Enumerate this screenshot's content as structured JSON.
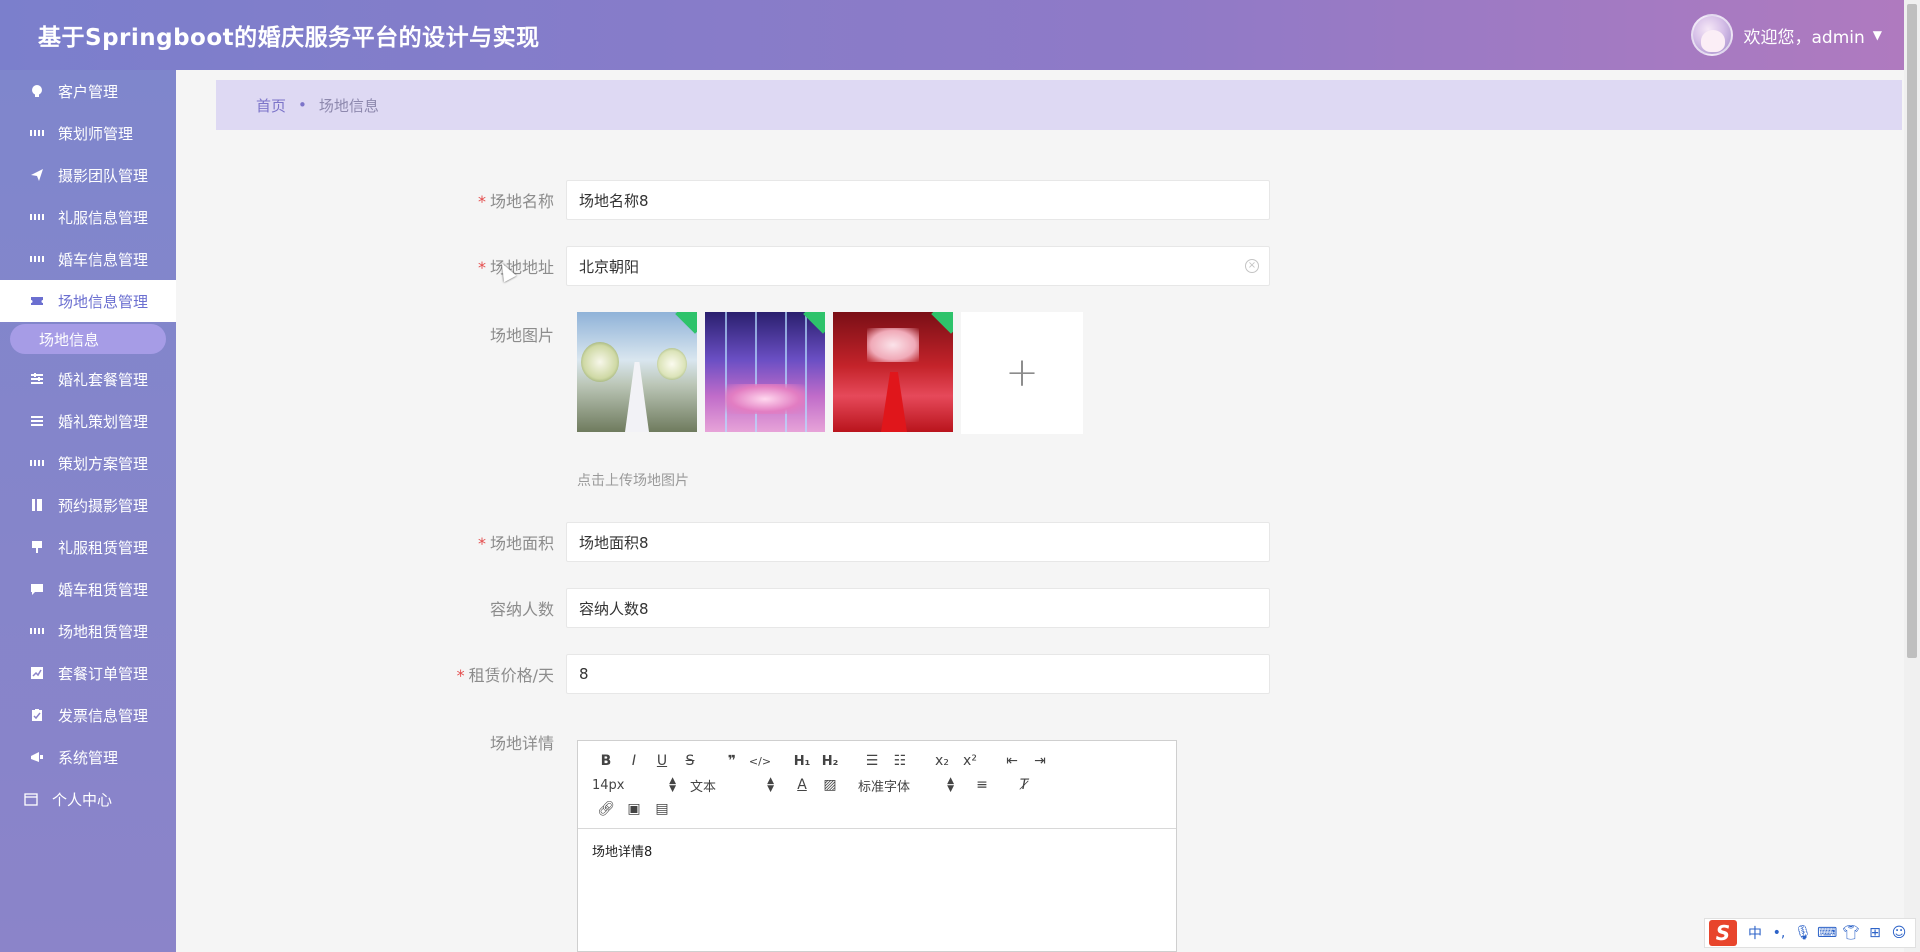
{
  "header": {
    "title": "基于Springboot的婚庆服务平台的设计与实现",
    "welcome": "欢迎您，admin",
    "caret": "▼"
  },
  "sidebar": {
    "items": [
      {
        "label": "客户管理",
        "icon": "bulb-icon"
      },
      {
        "label": "策划师管理",
        "icon": "grid-icon"
      },
      {
        "label": "摄影团队管理",
        "icon": "paper-plane-icon"
      },
      {
        "label": "礼服信息管理",
        "icon": "grid-icon"
      },
      {
        "label": "婚车信息管理",
        "icon": "grid-icon"
      },
      {
        "label": "场地信息管理",
        "icon": "ticket-icon",
        "active": true
      },
      {
        "label": "婚礼套餐管理",
        "icon": "sliders-icon"
      },
      {
        "label": "婚礼策划管理",
        "icon": "list-icon"
      },
      {
        "label": "策划方案管理",
        "icon": "grid-icon"
      },
      {
        "label": "预约摄影管理",
        "icon": "book-icon"
      },
      {
        "label": "礼服租赁管理",
        "icon": "brush-icon"
      },
      {
        "label": "婚车租赁管理",
        "icon": "chat-icon"
      },
      {
        "label": "场地租赁管理",
        "icon": "grid-icon"
      },
      {
        "label": "套餐订单管理",
        "icon": "chart-icon"
      },
      {
        "label": "发票信息管理",
        "icon": "clipboard-icon"
      },
      {
        "label": "系统管理",
        "icon": "megaphone-icon"
      }
    ],
    "sub_item": "场地信息",
    "personal": "个人中心"
  },
  "breadcrumb": {
    "home": "首页",
    "separator": "•",
    "current": "场地信息"
  },
  "form": {
    "venue_name_label": "场地名称",
    "venue_name_value": "场地名称8",
    "venue_address_label": "场地地址",
    "venue_address_value": "北京朝阳",
    "venue_image_label": "场地图片",
    "upload_hint": "点击上传场地图片",
    "upload_plus": "+",
    "venue_area_label": "场地面积",
    "venue_area_value": "场地面积8",
    "capacity_label": "容纳人数",
    "capacity_value": "容纳人数8",
    "price_label": "租赁价格/天",
    "price_value": "8",
    "detail_label": "场地详情",
    "required_mark": "*"
  },
  "editor": {
    "font_size": "14px",
    "text_type": "文本",
    "font_family": "标准字体",
    "content": "场地详情8"
  },
  "ime": {
    "logo": "S",
    "lang": "中"
  },
  "colors": {
    "accent": "#7b7fcc",
    "active_text": "#6b6fd0",
    "required": "#e44c4c"
  }
}
